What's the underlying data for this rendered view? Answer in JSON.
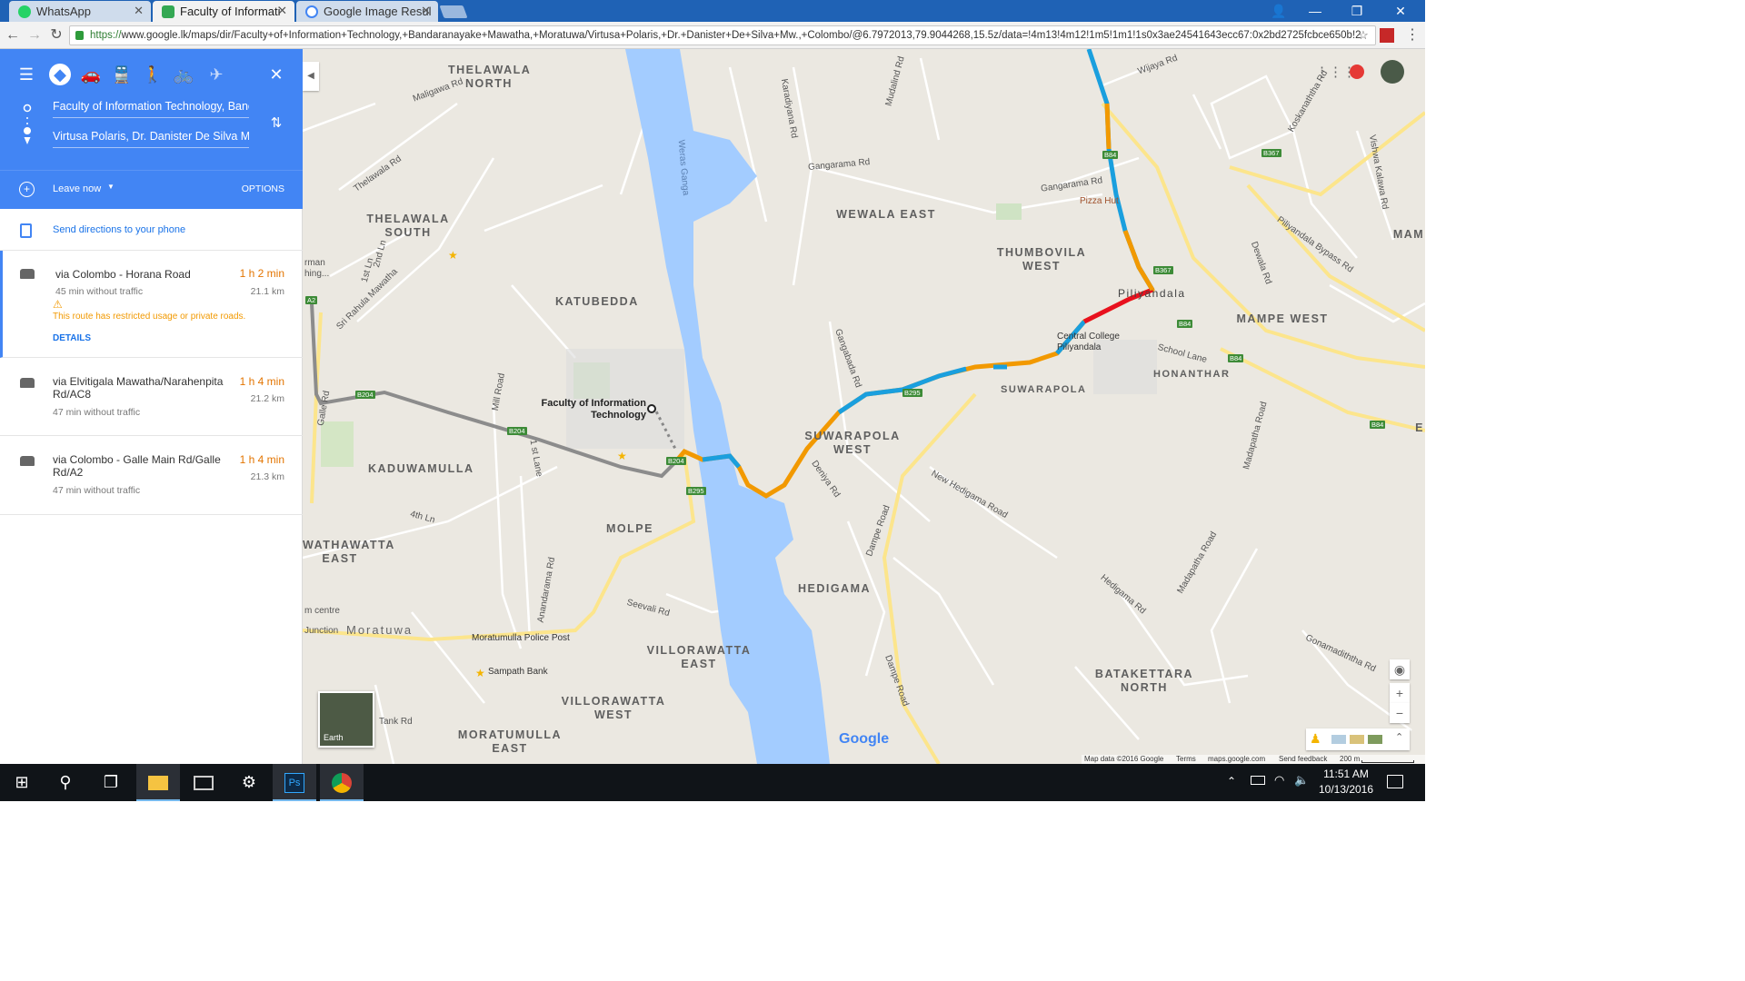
{
  "browser": {
    "tabs": [
      {
        "label": "WhatsApp",
        "icon": "whatsapp-icon",
        "color": "#25d366"
      },
      {
        "label": "Faculty of Informati",
        "icon": "google-maps-icon",
        "color": "#34a853"
      },
      {
        "label": "Google Image Resul",
        "icon": "google-icon",
        "color": "#4285f4"
      }
    ],
    "url_scheme": "https://",
    "url_rest": "www.google.lk/maps/dir/Faculty+of+Information+Technology,+Bandaranayake+Mawatha,+Moratuwa/Virtusa+Polaris,+Dr.+Danister+De+Silva+Mw.,+Colombo/@6.7972013,79.9044268,15.5z/data=!4m13!4m12!1m5!1m1!1s0x3ae24541643ecc67:0x2bd2725fcbce650b!2"
  },
  "directions": {
    "origin": "Faculty of Information Technology, Banc",
    "destination": "Virtusa Polaris, Dr. Danister De Silva Mw",
    "leave_label": "Leave now",
    "options_label": "OPTIONS",
    "send_label": "Send directions to your phone",
    "routes": [
      {
        "name": "via Colombo - Horana Road",
        "duration": "1 h 2 min",
        "distance": "21.1 km",
        "no_traffic": "45 min without traffic",
        "warning": "This route has restricted usage or private roads.",
        "details": "DETAILS"
      },
      {
        "name": "via Elvitigala Mawatha/Narahenpita Rd/AC8",
        "duration": "1 h 4 min",
        "distance": "21.2 km",
        "no_traffic": "47 min without traffic"
      },
      {
        "name": "via Colombo - Galle Main Rd/Galle Rd/A2",
        "duration": "1 h 4 min",
        "distance": "21.3 km",
        "no_traffic": "47 min without traffic"
      }
    ]
  },
  "map": {
    "areas": [
      "THELAWALA NORTH",
      "THELAWALA SOUTH",
      "KATUBEDDA",
      "KADUWAMULLA",
      "MOLPE",
      "WATHAWATTA EAST",
      "VILLORAWATTA EAST",
      "VILLORAWATTA WEST",
      "MORATUMULLA EAST",
      "HEDIGAMA",
      "WEWALA EAST",
      "THUMBOVILA WEST",
      "SUWARAPOLA WEST",
      "SUWARAPOLA",
      "HONANTHAR",
      "MAMPE WEST",
      "BATAKETTARA NORTH",
      "MAM",
      "E"
    ],
    "places": [
      "Faculty of Information Technology",
      "Pizza Hut",
      "Central College Piliyandala",
      "Moratumulla Police Post",
      "Sampath Bank",
      "Piliyandala",
      "Moratuwa",
      "m centre",
      "Junction",
      "rman",
      "hing..."
    ],
    "roads": [
      "Maligawa Rd",
      "Thelawala Rd",
      "2nd Ln",
      "1st Ln",
      "Sri Rahula Mawatha",
      "Galle Rd",
      "Mill Road",
      "1 st Lane",
      "4th Ln",
      "Anandarama Rd",
      "Seevali Rd",
      "Tank Rd",
      "Weras Ganga",
      "Karadiyana Rd",
      "Mudalind Rd",
      "Gangarama Rd",
      "Gangarama Rd",
      "Wijaya Rd",
      "Koskanaththa Rd",
      "Vishwa Kalawa Rd",
      "Piliyandala Bypass Rd",
      "Dewala Rd",
      "School Lane",
      "Gangabada Rd",
      "Deniya Rd",
      "New Hedigama Road",
      "Dampe Road",
      "Dampe Road",
      "Madapatha Road",
      "Madapatha Road",
      "Hedigama Rd",
      "Gonamadiththa Rd"
    ],
    "shields": [
      "A2",
      "B204",
      "B204",
      "B204",
      "B295",
      "B295",
      "B84",
      "B84",
      "B84",
      "B84",
      "B367",
      "B367"
    ],
    "earth_label": "Earth",
    "google_label": "Google",
    "footer": {
      "data": "Map data ©2016 Google",
      "terms": "Terms",
      "site": "maps.google.com",
      "feedback": "Send feedback",
      "scale": "200 m"
    }
  },
  "taskbar": {
    "time": "11:51 AM",
    "date": "10/13/2016"
  },
  "colors": {
    "brand": "#4285f4",
    "traffic_slow": "#f29900",
    "traffic_fast": "#1a9fde",
    "traffic_jam": "#e8101f",
    "water": "#a3ccff"
  }
}
